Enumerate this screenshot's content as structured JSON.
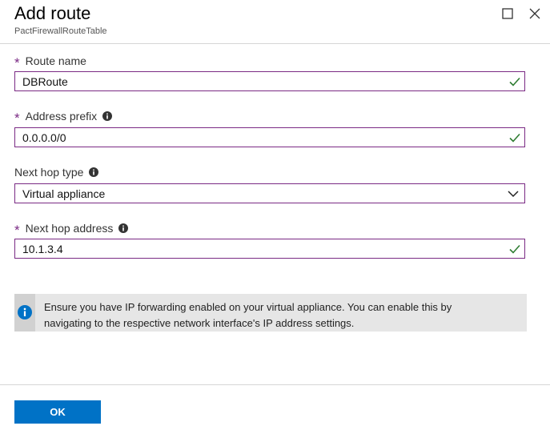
{
  "header": {
    "title": "Add route",
    "subtitle": "PactFirewallRouteTable"
  },
  "form": {
    "route_name": {
      "label": "Route name",
      "required_mark": "*",
      "value": "DBRoute"
    },
    "address_prefix": {
      "label": "Address prefix",
      "required_mark": "*",
      "value": "0.0.0.0/0"
    },
    "next_hop_type": {
      "label": "Next hop type",
      "value": "Virtual appliance"
    },
    "next_hop_address": {
      "label": "Next hop address",
      "required_mark": "*",
      "value": "10.1.3.4"
    }
  },
  "banner": {
    "line1": "Ensure you have IP forwarding enabled on your virtual appliance. You can enable this by",
    "line2": "navigating to the respective network interface's IP address settings."
  },
  "footer": {
    "ok_label": "OK"
  },
  "colors": {
    "accent_purple": "#7a2a84",
    "button_blue": "#0072c6",
    "check_green": "#2f7d32"
  }
}
